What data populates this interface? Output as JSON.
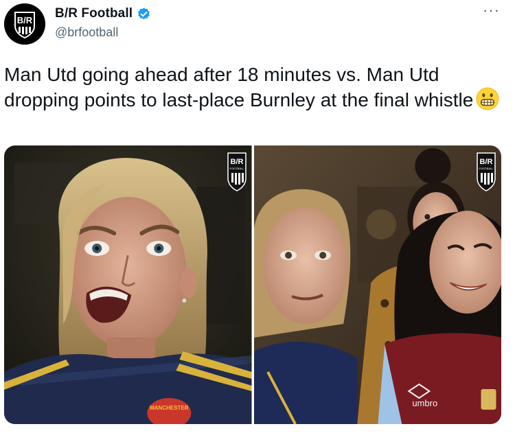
{
  "account": {
    "display_name": "B/R Football",
    "handle": "@brfootball",
    "avatar_icon": "br-logo-icon",
    "verified_icon": "verified-badge-icon",
    "verified_color": "#1d9bf0",
    "avatar_text": "B/R"
  },
  "menu": {
    "more_label": "···"
  },
  "tweet": {
    "text": "Man Utd going ahead after 18 minutes vs. Man Utd dropping points to last-place Burnley at the final whistle",
    "emoji_icon": "grimacing-face-icon"
  },
  "media": {
    "photos": [
      {
        "watermark_text": "B/R",
        "watermark_sub": "FOOTBALL"
      },
      {
        "watermark_text": "B/R",
        "watermark_sub": "FOOTBALL"
      }
    ],
    "shirt_text_left": "MANCHESTER",
    "shirt_text_right": "umbro"
  }
}
